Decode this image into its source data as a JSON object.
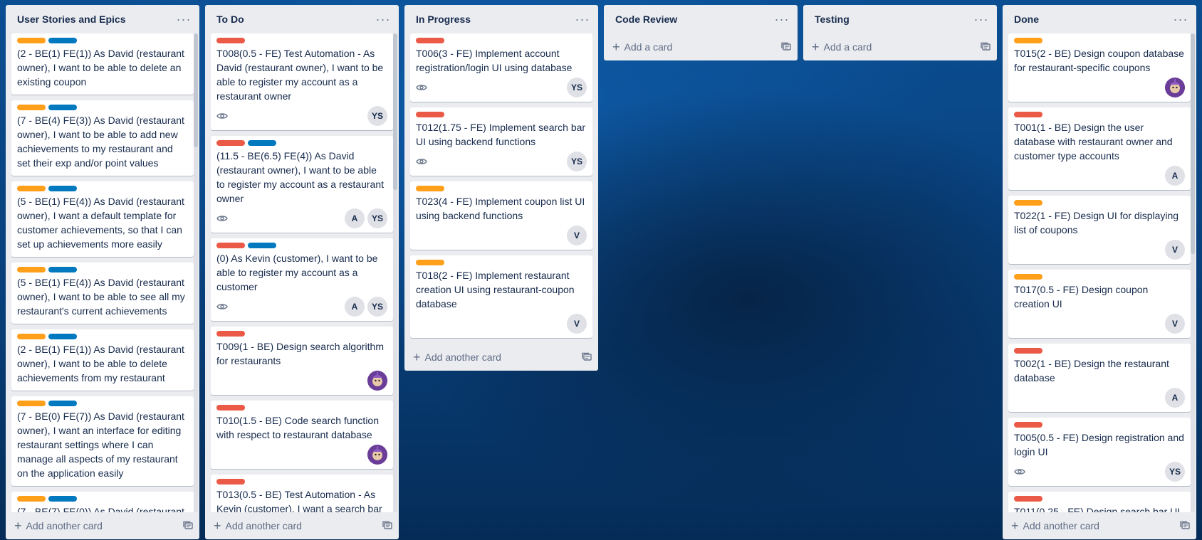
{
  "colors": {
    "orange": "#ff9f1a",
    "blue": "#0079bf",
    "red": "#eb5a46"
  },
  "lists": [
    {
      "title": "User Stories and Epics",
      "footer": "Add another card",
      "cards": [
        {
          "labels": [
            "orange",
            "blue"
          ],
          "title": "(2 - BE(1) FE(1)) As David (restaurant owner), I want to be able to delete an existing coupon"
        },
        {
          "labels": [
            "orange",
            "blue"
          ],
          "title": "(7 - BE(4) FE(3)) As David (restaurant owner), I want to be able to add new achievements to my restaurant and set their exp and/or point values"
        },
        {
          "labels": [
            "orange",
            "blue"
          ],
          "title": "(5 - BE(1) FE(4)) As David (restaurant owner), I want a default template for customer achievements, so that I can set up achievements more easily"
        },
        {
          "labels": [
            "orange",
            "blue"
          ],
          "title": "(5 - BE(1) FE(4)) As David (restaurant owner), I want to be able to see all my restaurant's current achievements"
        },
        {
          "labels": [
            "orange",
            "blue"
          ],
          "title": "(2 - BE(1) FE(1)) As David (restaurant owner), I want to be able to delete achievements from my restaurant"
        },
        {
          "labels": [
            "orange",
            "blue"
          ],
          "title": "(7 - BE(0) FE(7)) As David (restaurant owner), I want an interface for editing restaurant settings where I can manage all aspects of my restaurant on the application easily"
        },
        {
          "labels": [
            "orange",
            "blue"
          ],
          "title": "(7 - BE(7) FE(0)) As David (restaurant"
        }
      ]
    },
    {
      "title": "To Do",
      "footer": "Add another card",
      "cards": [
        {
          "labels": [
            "red"
          ],
          "title": "T008(0.5 - FE) Test Automation - As David (restaurant owner), I want to be able to register my account as a restaurant owner",
          "watch": true,
          "members": [
            "YS"
          ]
        },
        {
          "labels": [
            "red",
            "blue"
          ],
          "title": "(11.5 - BE(6.5) FE(4)) As David (restaurant owner), I want to be able to register my account as a restaurant owner",
          "watch": true,
          "members": [
            "A",
            "YS"
          ]
        },
        {
          "labels": [
            "red",
            "blue"
          ],
          "title": "(0) As Kevin (customer), I want to be able to register my account as a customer",
          "watch": true,
          "members": [
            "A",
            "YS"
          ]
        },
        {
          "labels": [
            "red"
          ],
          "title": "T009(1 - BE) Design search algorithm for restaurants",
          "members": [
            "img"
          ]
        },
        {
          "labels": [
            "red"
          ],
          "title": "T010(1.5 - BE) Code search function with respect to restaurant database",
          "members": [
            "img"
          ]
        },
        {
          "labels": [
            "red"
          ],
          "title": "T013(0.5 - BE) Test Automation - As Kevin (customer), I want a search bar"
        }
      ]
    },
    {
      "title": "In Progress",
      "footer": "Add another card",
      "cards": [
        {
          "labels": [
            "red"
          ],
          "title": "T006(3 - FE) Implement account registration/login UI using database",
          "watch": true,
          "members": [
            "YS"
          ]
        },
        {
          "labels": [
            "red"
          ],
          "title": "T012(1.75 - FE) Implement search bar UI using backend functions",
          "watch": true,
          "members": [
            "YS"
          ]
        },
        {
          "labels": [
            "orange"
          ],
          "title": "T023(4 - FE) Implement coupon list UI using backend functions",
          "members": [
            "V"
          ]
        },
        {
          "labels": [
            "orange"
          ],
          "title": "T018(2 - FE) Implement restaurant creation UI using restaurant-coupon database",
          "members": [
            "V"
          ]
        }
      ]
    },
    {
      "title": "Code Review",
      "footer": "Add a card",
      "cards": []
    },
    {
      "title": "Testing",
      "footer": "Add a card",
      "cards": []
    },
    {
      "title": "Done",
      "footer": "Add another card",
      "cards": [
        {
          "labels": [
            "orange"
          ],
          "title": "T015(2 - BE) Design coupon database for restaurant-specific coupons",
          "members": [
            "img"
          ]
        },
        {
          "labels": [
            "red"
          ],
          "title": "T001(1 - BE) Design the user database with restaurant owner and customer type accounts",
          "members": [
            "A"
          ]
        },
        {
          "labels": [
            "orange"
          ],
          "title": "T022(1 - FE) Design UI for displaying list of coupons",
          "members": [
            "V"
          ]
        },
        {
          "labels": [
            "orange"
          ],
          "title": "T017(0.5 - FE) Design coupon creation UI",
          "members": [
            "V"
          ]
        },
        {
          "labels": [
            "red"
          ],
          "title": "T002(1 - BE) Design the restaurant database",
          "members": [
            "A"
          ]
        },
        {
          "labels": [
            "red"
          ],
          "title": "T005(0.5 - FE) Design registration and login UI",
          "watch": true,
          "members": [
            "YS"
          ]
        },
        {
          "labels": [
            "red"
          ],
          "title": "T011(0.25 - FE) Design search bar UI"
        }
      ]
    }
  ]
}
